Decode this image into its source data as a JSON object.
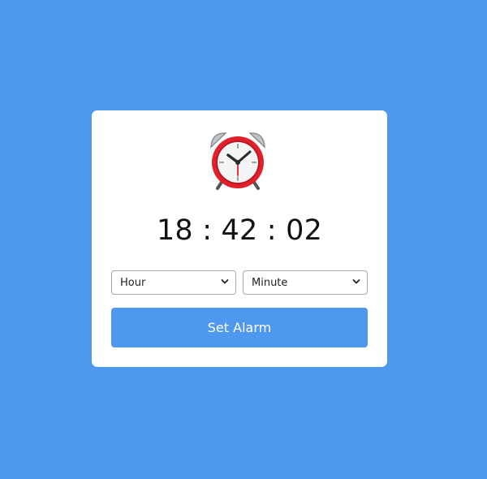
{
  "colors": {
    "background": "#4f98ef",
    "card": "#ffffff",
    "button": "#4f98ef",
    "clock_ring": "#e2202b"
  },
  "clock": {
    "icon": "alarm-clock-icon",
    "time": "18 : 42 : 02"
  },
  "controls": {
    "hour_select": {
      "selected": "Hour"
    },
    "minute_select": {
      "selected": "Minute"
    },
    "set_alarm_label": "Set Alarm"
  }
}
